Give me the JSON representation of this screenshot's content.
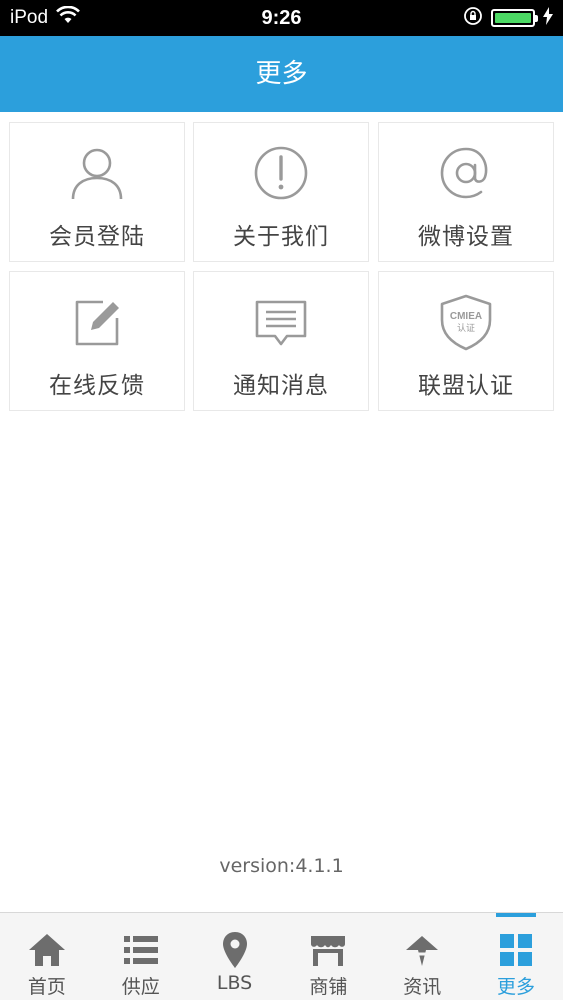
{
  "status_bar": {
    "carrier": "iPod",
    "time": "9:26"
  },
  "header": {
    "title": "更多"
  },
  "grid": [
    {
      "label": "会员登陆",
      "icon": "user-icon"
    },
    {
      "label": "关于我们",
      "icon": "info-exclamation-icon"
    },
    {
      "label": "微博设置",
      "icon": "at-icon"
    },
    {
      "label": "在线反馈",
      "icon": "edit-icon"
    },
    {
      "label": "通知消息",
      "icon": "message-icon"
    },
    {
      "label": "联盟认证",
      "icon": "shield-badge-icon",
      "badge_lines": [
        "CMIEA",
        "认证"
      ]
    }
  ],
  "version": "version:4.1.1",
  "tabs": [
    {
      "label": "首页",
      "icon": "home-icon"
    },
    {
      "label": "供应",
      "icon": "list-icon"
    },
    {
      "label": "LBS",
      "icon": "location-pin-icon"
    },
    {
      "label": "商铺",
      "icon": "store-icon"
    },
    {
      "label": "资讯",
      "icon": "news-icon"
    },
    {
      "label": "更多",
      "icon": "grid-icon",
      "active": true
    }
  ],
  "colors": {
    "accent": "#2c9fdc",
    "icon_gray": "#9a9a9a",
    "tab_icon": "#6d6d6d"
  }
}
